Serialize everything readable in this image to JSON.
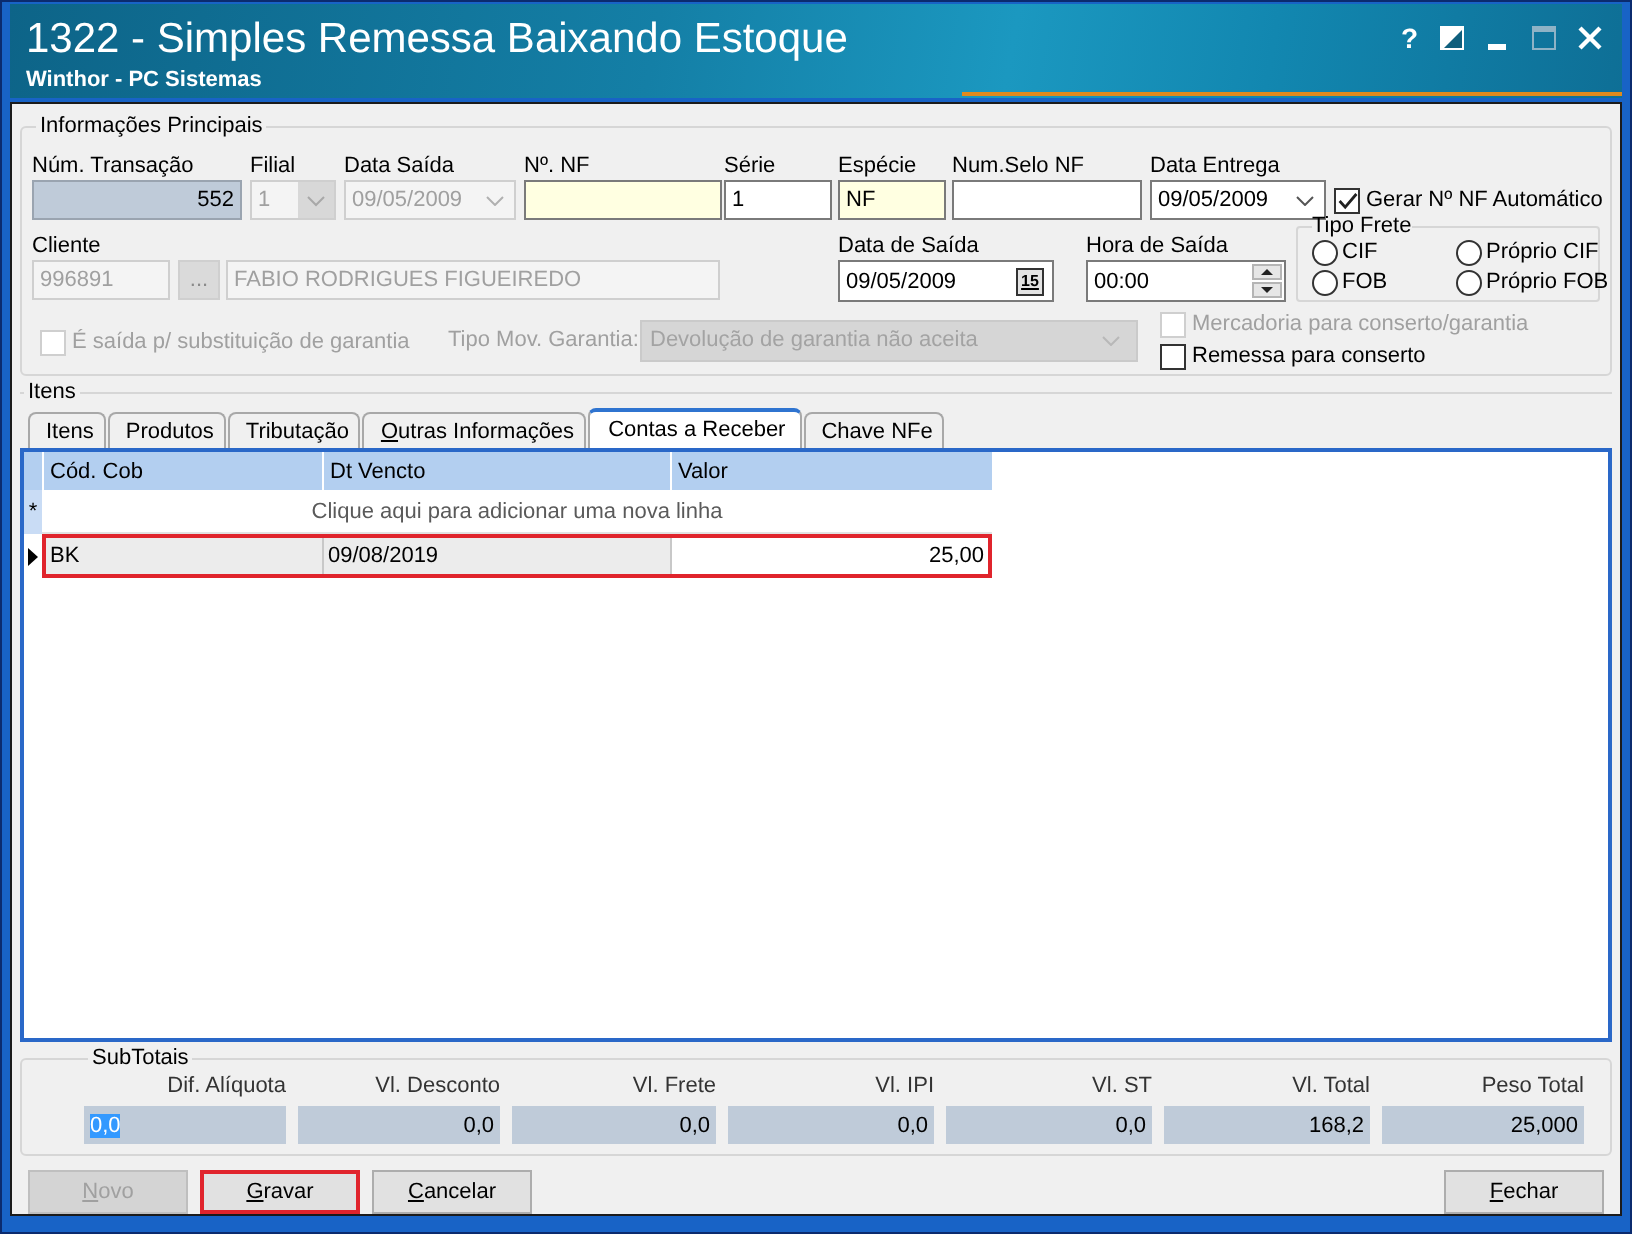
{
  "window": {
    "title": "1322 - Simples Remessa Baixando Estoque",
    "subtitle": "Winthor - PC Sistemas",
    "controls": [
      {
        "kind": "help",
        "glyph": "?",
        "disabled": false
      },
      {
        "kind": "contrast",
        "disabled": false
      },
      {
        "kind": "minimize",
        "disabled": false
      },
      {
        "kind": "maximize",
        "disabled": true
      },
      {
        "kind": "close",
        "disabled": false
      }
    ]
  },
  "main_info": {
    "title": "Informações Principais",
    "fields": [
      {
        "label": "Núm. Transação",
        "kind": "number",
        "value": "552",
        "readonly": true,
        "disabled": false,
        "highlighted": false
      },
      {
        "label": "Filial",
        "kind": "combo",
        "value": "1",
        "readonly": false,
        "disabled": true,
        "highlighted": false
      },
      {
        "label": "Data Saída",
        "kind": "date",
        "value": "09/05/2009",
        "readonly": false,
        "disabled": true,
        "highlighted": false
      },
      {
        "label": "Nº. NF",
        "kind": "text",
        "readonly": false,
        "disabled": false,
        "highlighted": true
      },
      {
        "label": "Série",
        "kind": "text",
        "value": "1",
        "readonly": false,
        "disabled": false,
        "highlighted": false
      },
      {
        "label": "Espécie",
        "kind": "text",
        "value": "NF",
        "readonly": false,
        "disabled": false,
        "highlighted": true
      },
      {
        "label": "Num.Selo NF",
        "kind": "text",
        "readonly": false,
        "disabled": false,
        "highlighted": false
      },
      {
        "label": "Data Entrega",
        "kind": "date",
        "value": "09/05/2009",
        "readonly": false,
        "disabled": false,
        "highlighted": false
      }
    ],
    "auto_nf": {
      "label": "Gerar Nº NF Automático",
      "checked": true,
      "disabled": false
    },
    "client": {
      "label": "Cliente",
      "code": "996891",
      "lookup": "...",
      "name": "FABIO RODRIGUES FIGUEIREDO",
      "disabled": true
    },
    "exit_date": {
      "label": "Data de Saída",
      "value": "09/05/2009",
      "calendar": "15"
    },
    "exit_time": {
      "label": "Hora de Saída",
      "value": "00:00"
    },
    "freight": {
      "title": "Tipo Frete",
      "options": [
        {
          "label": "CIF",
          "selected": false
        },
        {
          "label": "Próprio CIF",
          "selected": false
        },
        {
          "label": "FOB",
          "selected": false
        },
        {
          "label": "Próprio FOB",
          "selected": false
        }
      ]
    },
    "warranty_exit": {
      "label": "É saída p/ substituição de garantia",
      "checked": false,
      "disabled": true
    },
    "warranty_type": {
      "label": "Tipo Mov. Garantia:",
      "value": "Devolução de garantia não aceita",
      "disabled": true
    },
    "options": [
      {
        "label": "Mercadoria para conserto/garantia",
        "checked": false,
        "disabled": true
      },
      {
        "label": "Remessa para conserto",
        "checked": false,
        "disabled": false
      }
    ]
  },
  "items": {
    "title": "Itens",
    "tabs": [
      {
        "label": "Itens",
        "selected": false,
        "mnemonic": false
      },
      {
        "label": "Produtos",
        "selected": false,
        "mnemonic": false
      },
      {
        "label": "Tributação",
        "selected": false,
        "mnemonic": false
      },
      {
        "label": "Outras Informações",
        "selected": false,
        "mnemonic": true
      },
      {
        "label": "Contas a Receber",
        "selected": true,
        "mnemonic": false
      },
      {
        "label": "Chave NFe",
        "selected": false,
        "mnemonic": false
      }
    ],
    "grid": {
      "columns": [
        {
          "label": "Cód. Cob",
          "kind": "text"
        },
        {
          "label": "Dt Vencto",
          "kind": "date"
        },
        {
          "label": "Valor",
          "kind": "money"
        }
      ],
      "new_row": {
        "marker": "*",
        "hint": "Clique aqui para adicionar uma nova linha"
      },
      "rows": [
        {
          "current": true,
          "highlighted": true,
          "cells": [
            {
              "text": "BK",
              "focused": false
            },
            {
              "text": "09/08/2019",
              "focused": false
            },
            {
              "text": "25,00",
              "focused": true
            }
          ]
        }
      ]
    }
  },
  "subtotals": {
    "title": "SubTotais",
    "items": [
      {
        "label": "Dif. Alíquota",
        "value": "0,0",
        "selected": true
      },
      {
        "label": "Vl. Desconto",
        "value": "0,0",
        "selected": false
      },
      {
        "label": "Vl. Frete",
        "value": "0,0",
        "selected": false
      },
      {
        "label": "Vl. IPI",
        "value": "0,0",
        "selected": false
      },
      {
        "label": "Vl. ST",
        "value": "0,0",
        "selected": false
      },
      {
        "label": "Vl. Total",
        "value": "168,2",
        "selected": false
      },
      {
        "label": "Peso Total",
        "value": "25,000",
        "selected": false
      }
    ]
  },
  "buttons_left": [
    {
      "label": "Novo",
      "disabled": true,
      "highlighted": false,
      "mnemonic": true
    },
    {
      "label": "Gravar",
      "disabled": false,
      "highlighted": true,
      "mnemonic": true
    },
    {
      "label": "Cancelar",
      "disabled": false,
      "highlighted": false,
      "mnemonic": true
    }
  ],
  "buttons_right": [
    {
      "label": "Fechar",
      "disabled": false,
      "highlighted": false,
      "mnemonic": true
    }
  ]
}
